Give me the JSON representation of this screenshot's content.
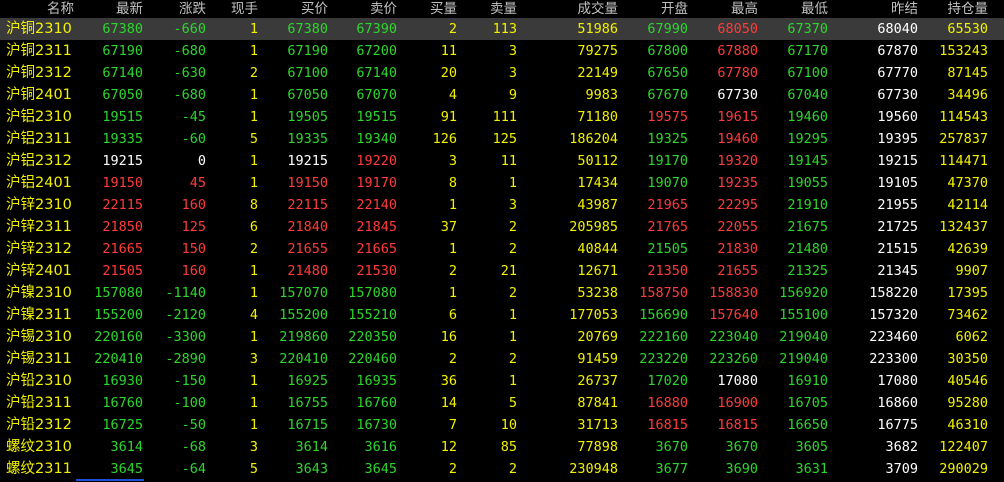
{
  "headers": {
    "name": "名称",
    "last": "最新",
    "change": "涨跌",
    "vol_now": "现手",
    "bid": "买价",
    "ask": "卖价",
    "bid_vol": "买量",
    "ask_vol": "卖量",
    "volume": "成交量",
    "open": "开盘",
    "high": "最高",
    "low": "最低",
    "prev_close": "昨结",
    "open_interest": "持仓量"
  },
  "colors": {
    "up": "#ff3b3b",
    "down": "#2dd62d",
    "flat": "#ffffff",
    "yellow": "#f2f200",
    "header": "#c0c0c0",
    "selected_row": "#3a3a3a"
  },
  "selected_row_index": 0,
  "rows": [
    {
      "name": "沪铜2310",
      "last": "67380",
      "change": "-660",
      "vol_now": "1",
      "bid": "67380",
      "ask": "67390",
      "bid_vol": "2",
      "ask_vol": "113",
      "volume": "51986",
      "open": "67990",
      "high": "68050",
      "low": "67370",
      "prev_close": "68040",
      "open_interest": "65530"
    },
    {
      "name": "沪铜2311",
      "last": "67190",
      "change": "-680",
      "vol_now": "1",
      "bid": "67190",
      "ask": "67200",
      "bid_vol": "11",
      "ask_vol": "3",
      "volume": "79275",
      "open": "67800",
      "high": "67880",
      "low": "67170",
      "prev_close": "67870",
      "open_interest": "153243"
    },
    {
      "name": "沪铜2312",
      "last": "67140",
      "change": "-630",
      "vol_now": "2",
      "bid": "67100",
      "ask": "67140",
      "bid_vol": "20",
      "ask_vol": "3",
      "volume": "22149",
      "open": "67650",
      "high": "67780",
      "low": "67100",
      "prev_close": "67770",
      "open_interest": "87145"
    },
    {
      "name": "沪铜2401",
      "last": "67050",
      "change": "-680",
      "vol_now": "1",
      "bid": "67050",
      "ask": "67070",
      "bid_vol": "4",
      "ask_vol": "9",
      "volume": "9983",
      "open": "67670",
      "high": "67730",
      "low": "67040",
      "prev_close": "67730",
      "open_interest": "34496"
    },
    {
      "name": "沪铝2310",
      "last": "19515",
      "change": "-45",
      "vol_now": "1",
      "bid": "19505",
      "ask": "19515",
      "bid_vol": "91",
      "ask_vol": "111",
      "volume": "71180",
      "open": "19575",
      "high": "19615",
      "low": "19460",
      "prev_close": "19560",
      "open_interest": "114543"
    },
    {
      "name": "沪铝2311",
      "last": "19335",
      "change": "-60",
      "vol_now": "5",
      "bid": "19335",
      "ask": "19340",
      "bid_vol": "126",
      "ask_vol": "125",
      "volume": "186204",
      "open": "19325",
      "high": "19460",
      "low": "19295",
      "prev_close": "19395",
      "open_interest": "257837"
    },
    {
      "name": "沪铝2312",
      "last": "19215",
      "change": "0",
      "vol_now": "1",
      "bid": "19215",
      "ask": "19220",
      "bid_vol": "3",
      "ask_vol": "11",
      "volume": "50112",
      "open": "19170",
      "high": "19320",
      "low": "19145",
      "prev_close": "19215",
      "open_interest": "114471"
    },
    {
      "name": "沪铝2401",
      "last": "19150",
      "change": "45",
      "vol_now": "1",
      "bid": "19150",
      "ask": "19170",
      "bid_vol": "8",
      "ask_vol": "1",
      "volume": "17434",
      "open": "19070",
      "high": "19235",
      "low": "19055",
      "prev_close": "19105",
      "open_interest": "47370"
    },
    {
      "name": "沪锌2310",
      "last": "22115",
      "change": "160",
      "vol_now": "8",
      "bid": "22115",
      "ask": "22140",
      "bid_vol": "1",
      "ask_vol": "3",
      "volume": "43987",
      "open": "21965",
      "high": "22295",
      "low": "21910",
      "prev_close": "21955",
      "open_interest": "42114"
    },
    {
      "name": "沪锌2311",
      "last": "21850",
      "change": "125",
      "vol_now": "6",
      "bid": "21840",
      "ask": "21845",
      "bid_vol": "37",
      "ask_vol": "2",
      "volume": "205985",
      "open": "21765",
      "high": "22055",
      "low": "21675",
      "prev_close": "21725",
      "open_interest": "132437"
    },
    {
      "name": "沪锌2312",
      "last": "21665",
      "change": "150",
      "vol_now": "2",
      "bid": "21655",
      "ask": "21665",
      "bid_vol": "1",
      "ask_vol": "2",
      "volume": "40844",
      "open": "21505",
      "high": "21830",
      "low": "21480",
      "prev_close": "21515",
      "open_interest": "42639"
    },
    {
      "name": "沪锌2401",
      "last": "21505",
      "change": "160",
      "vol_now": "1",
      "bid": "21480",
      "ask": "21530",
      "bid_vol": "2",
      "ask_vol": "21",
      "volume": "12671",
      "open": "21350",
      "high": "21655",
      "low": "21325",
      "prev_close": "21345",
      "open_interest": "9907"
    },
    {
      "name": "沪镍2310",
      "last": "157080",
      "change": "-1140",
      "vol_now": "1",
      "bid": "157070",
      "ask": "157080",
      "bid_vol": "1",
      "ask_vol": "2",
      "volume": "53238",
      "open": "158750",
      "high": "158830",
      "low": "156920",
      "prev_close": "158220",
      "open_interest": "17395"
    },
    {
      "name": "沪镍2311",
      "last": "155200",
      "change": "-2120",
      "vol_now": "4",
      "bid": "155200",
      "ask": "155210",
      "bid_vol": "6",
      "ask_vol": "1",
      "volume": "177053",
      "open": "156690",
      "high": "157640",
      "low": "155100",
      "prev_close": "157320",
      "open_interest": "73462"
    },
    {
      "name": "沪锡2310",
      "last": "220160",
      "change": "-3300",
      "vol_now": "1",
      "bid": "219860",
      "ask": "220350",
      "bid_vol": "16",
      "ask_vol": "1",
      "volume": "20769",
      "open": "222160",
      "high": "223040",
      "low": "219040",
      "prev_close": "223460",
      "open_interest": "6062"
    },
    {
      "name": "沪锡2311",
      "last": "220410",
      "change": "-2890",
      "vol_now": "3",
      "bid": "220410",
      "ask": "220460",
      "bid_vol": "2",
      "ask_vol": "2",
      "volume": "91459",
      "open": "223220",
      "high": "223260",
      "low": "219040",
      "prev_close": "223300",
      "open_interest": "30350"
    },
    {
      "name": "沪铅2310",
      "last": "16930",
      "change": "-150",
      "vol_now": "1",
      "bid": "16925",
      "ask": "16935",
      "bid_vol": "36",
      "ask_vol": "1",
      "volume": "26737",
      "open": "17020",
      "high": "17080",
      "low": "16910",
      "prev_close": "17080",
      "open_interest": "40546"
    },
    {
      "name": "沪铅2311",
      "last": "16760",
      "change": "-100",
      "vol_now": "1",
      "bid": "16755",
      "ask": "16760",
      "bid_vol": "14",
      "ask_vol": "5",
      "volume": "87841",
      "open": "16880",
      "high": "16900",
      "low": "16705",
      "prev_close": "16860",
      "open_interest": "95280"
    },
    {
      "name": "沪铅2312",
      "last": "16725",
      "change": "-50",
      "vol_now": "1",
      "bid": "16715",
      "ask": "16730",
      "bid_vol": "7",
      "ask_vol": "10",
      "volume": "31713",
      "open": "16815",
      "high": "16815",
      "low": "16650",
      "prev_close": "16775",
      "open_interest": "46310"
    },
    {
      "name": "螺纹2310",
      "last": "3614",
      "change": "-68",
      "vol_now": "3",
      "bid": "3614",
      "ask": "3616",
      "bid_vol": "12",
      "ask_vol": "85",
      "volume": "77898",
      "open": "3670",
      "high": "3670",
      "low": "3605",
      "prev_close": "3682",
      "open_interest": "122407"
    },
    {
      "name": "螺纹2311",
      "last": "3645",
      "change": "-64",
      "vol_now": "5",
      "bid": "3643",
      "ask": "3645",
      "bid_vol": "2",
      "ask_vol": "2",
      "volume": "230948",
      "open": "3677",
      "high": "3690",
      "low": "3631",
      "prev_close": "3709",
      "open_interest": "290029"
    }
  ]
}
